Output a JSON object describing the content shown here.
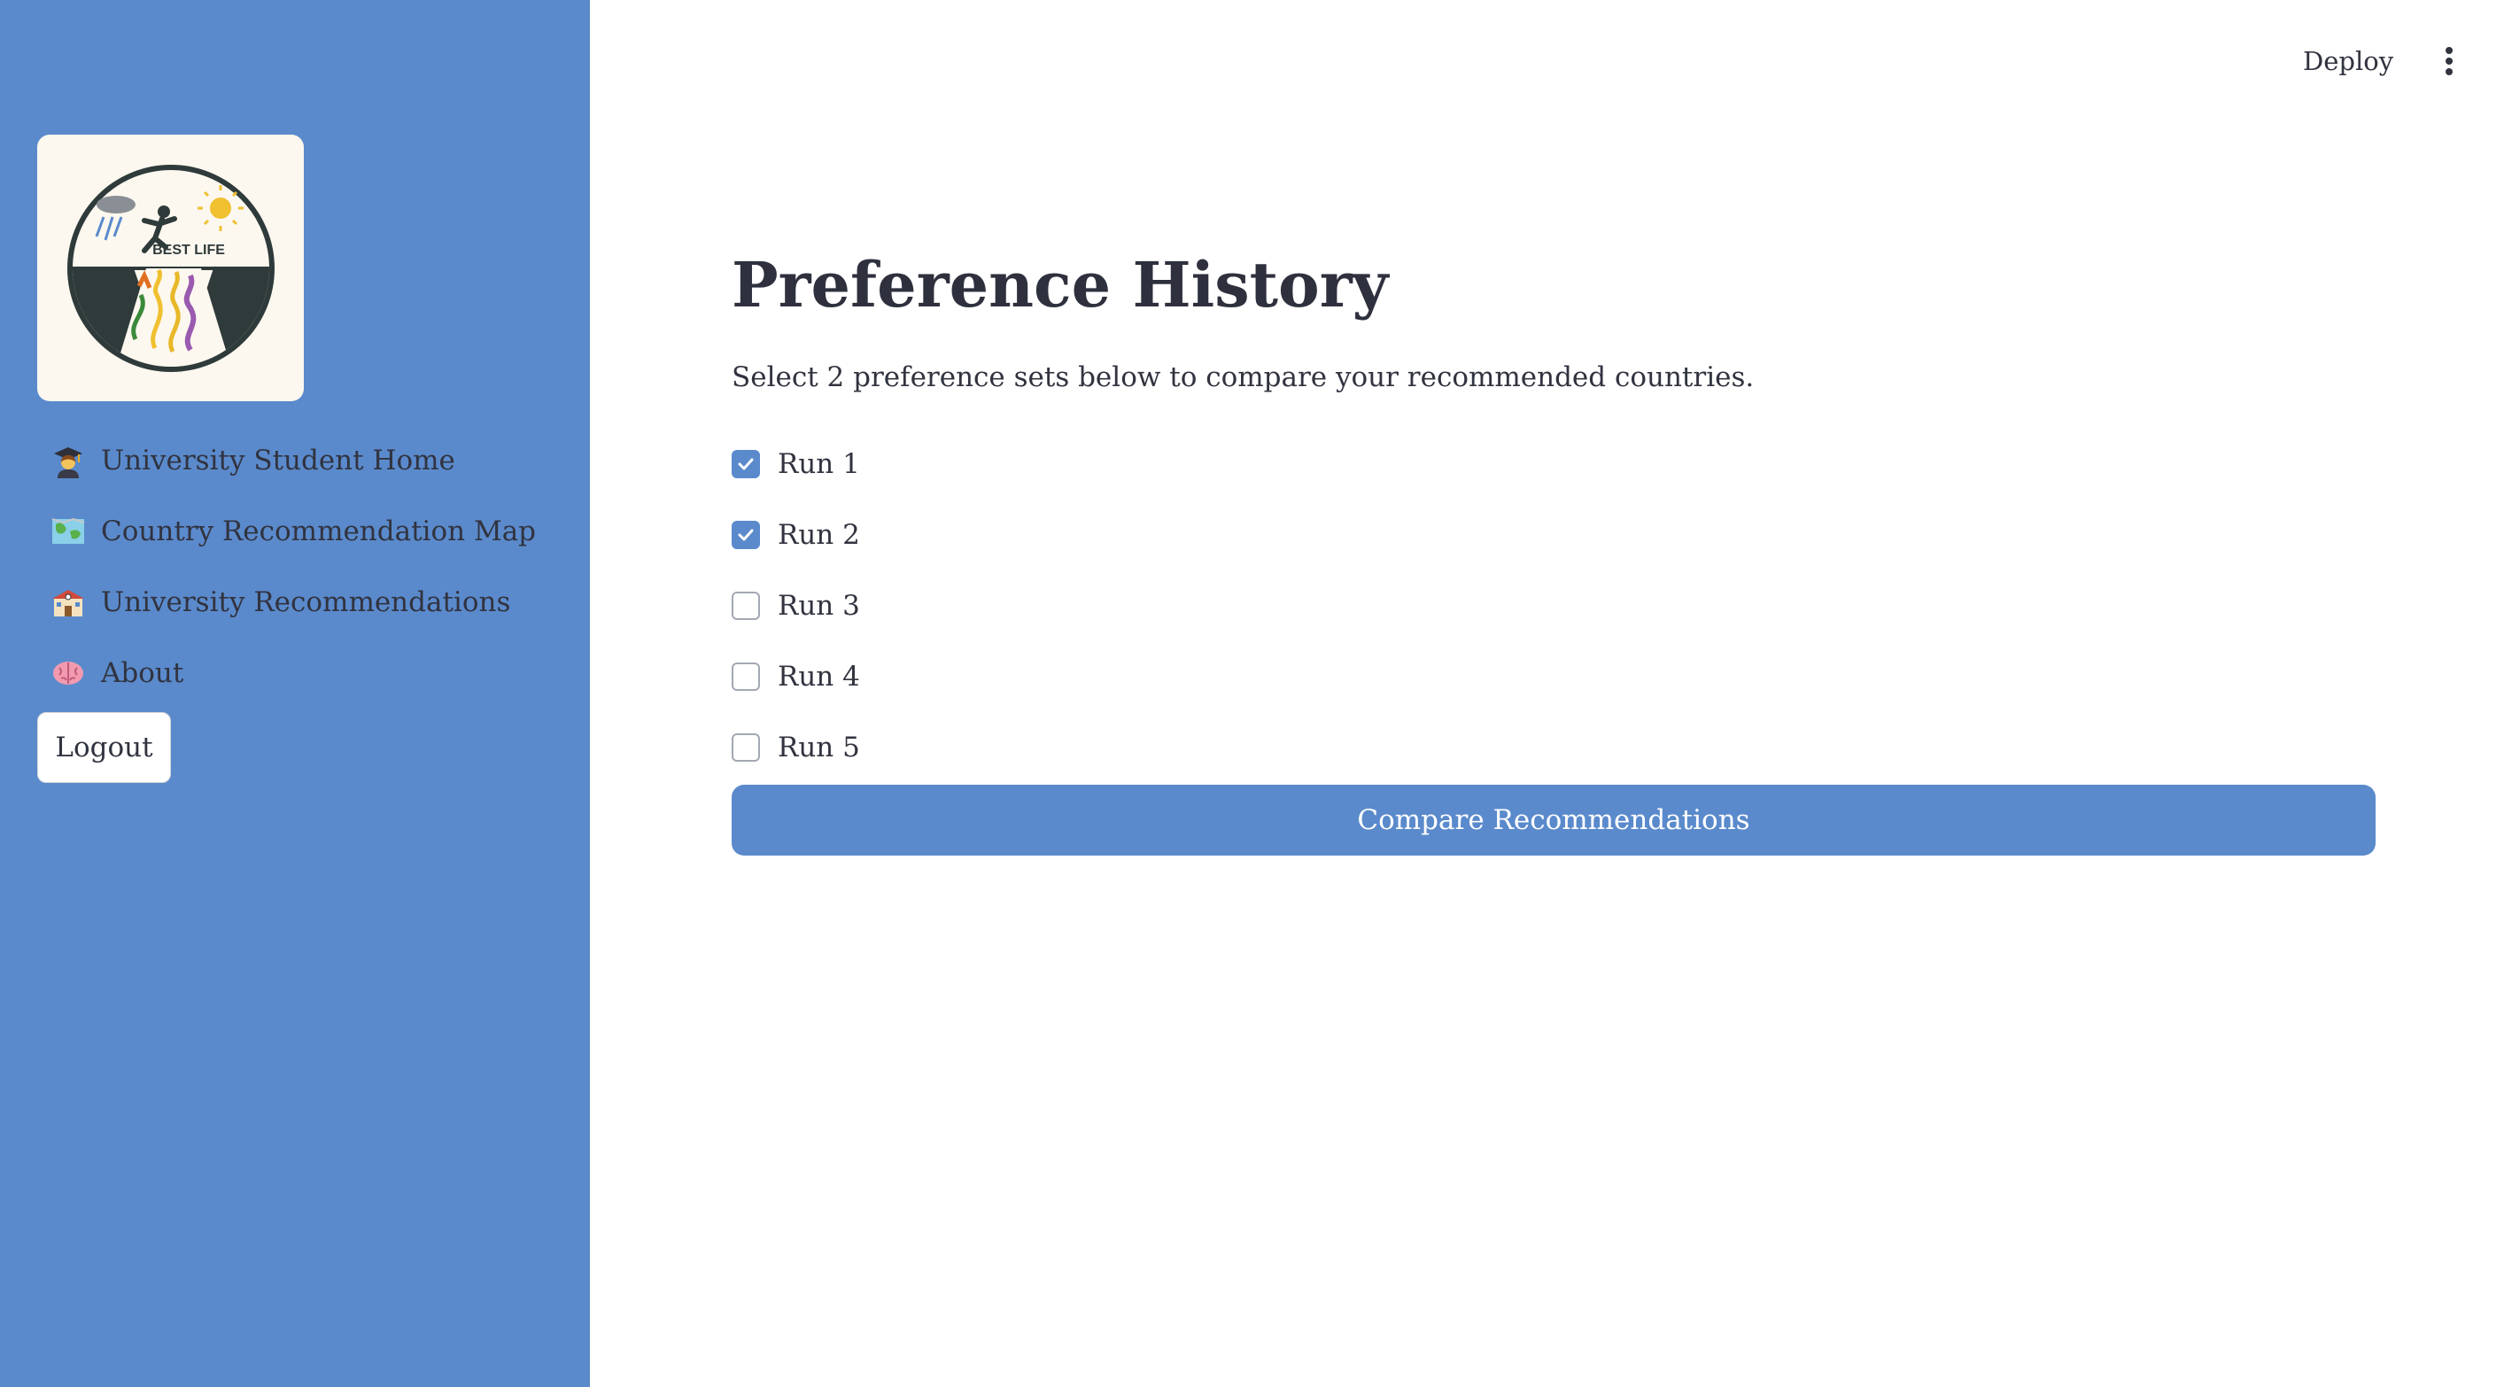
{
  "header": {
    "deploy_label": "Deploy",
    "menu_icon": "more-vertical-icon"
  },
  "sidebar": {
    "logo_text": "BEST LIFE",
    "items": [
      {
        "label": "University Student Home",
        "icon": "student-icon"
      },
      {
        "label": "Country Recommendation Map",
        "icon": "map-icon"
      },
      {
        "label": "University Recommendations",
        "icon": "school-building-icon"
      },
      {
        "label": "About",
        "icon": "brain-icon"
      }
    ],
    "logout_label": "Logout"
  },
  "main": {
    "title": "Preference History",
    "subtitle": "Select 2 preference sets below to compare your recommended countries.",
    "runs": [
      {
        "label": "Run 1",
        "checked": true
      },
      {
        "label": "Run 2",
        "checked": true
      },
      {
        "label": "Run 3",
        "checked": false
      },
      {
        "label": "Run 4",
        "checked": false
      },
      {
        "label": "Run 5",
        "checked": false
      }
    ],
    "compare_label": "Compare Recommendations"
  },
  "colors": {
    "sidebar_bg": "#5a8acc",
    "accent": "#5a8acc",
    "text": "#31333f",
    "logo_card_bg": "#fcf8ef"
  }
}
